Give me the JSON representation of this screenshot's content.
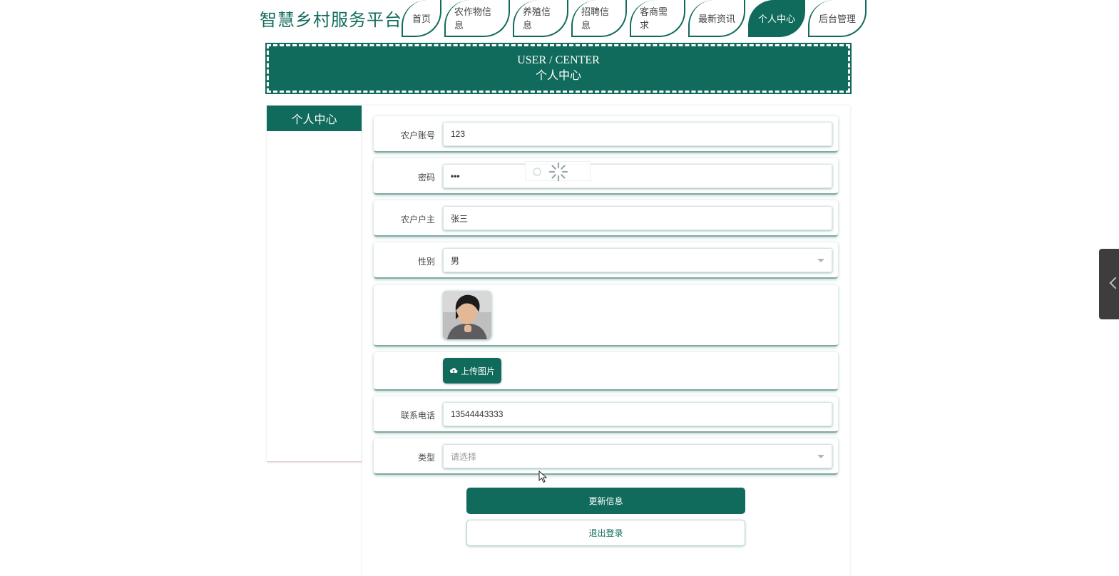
{
  "header": {
    "site_title": "智慧乡村服务平台",
    "nav": [
      {
        "label": "首页"
      },
      {
        "label": "农作物信息"
      },
      {
        "label": "养殖信息"
      },
      {
        "label": "招聘信息"
      },
      {
        "label": "客商需求"
      },
      {
        "label": "最新资讯"
      },
      {
        "label": "个人中心",
        "active": true
      },
      {
        "label": "后台管理"
      }
    ]
  },
  "banner": {
    "title_en": "USER / CENTER",
    "title_cn": "个人中心"
  },
  "sidebar": {
    "heading": "个人中心"
  },
  "form": {
    "account": {
      "label": "农户账号",
      "value": "123"
    },
    "password": {
      "label": "密码",
      "value": "•••"
    },
    "owner": {
      "label": "农户户主",
      "value": "张三"
    },
    "gender": {
      "label": "性别",
      "value": "男"
    },
    "upload_label": "上传图片",
    "phone": {
      "label": "联系电话",
      "value": "13544443333"
    },
    "type": {
      "label": "类型",
      "placeholder": "请选择"
    },
    "update_button": "更新信息",
    "logout_button": "退出登录"
  },
  "colors": {
    "brand": "#116b5c",
    "handle": "#3d3d3d"
  },
  "icons": {
    "upload": "cloud-upload-icon",
    "spinner": "loading-spinner-icon",
    "collapse": "chevron-left-icon"
  }
}
